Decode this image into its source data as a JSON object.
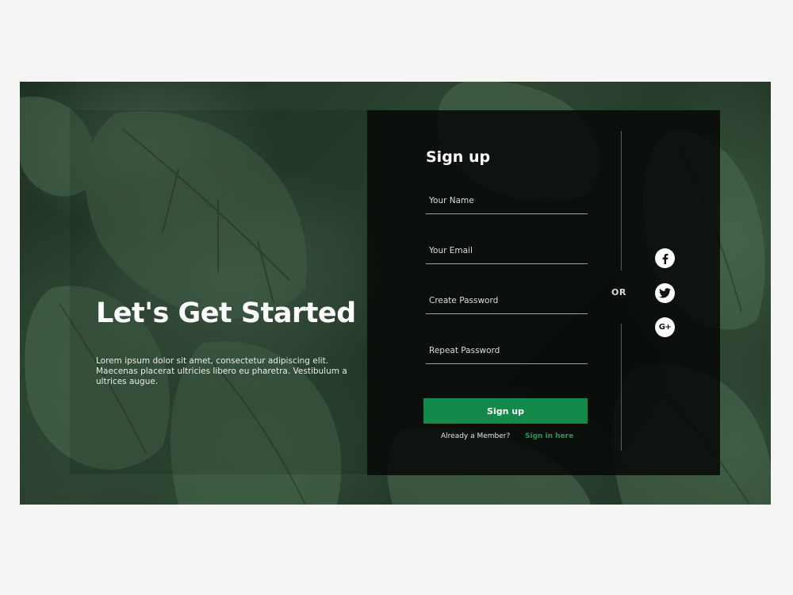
{
  "hero": {
    "title": "Let's Get Started",
    "text": "Lorem ipsum dolor sit amet, consectetur adipiscing elit. Maecenas placerat ultricies libero eu pharetra. Vestibulum a ultrices augue."
  },
  "form": {
    "title": "Sign up",
    "name_placeholder": "Your Name",
    "email_placeholder": "Your Email",
    "password_placeholder": "Create Password",
    "repeat_password_placeholder": "Repeat Password",
    "submit_label": "Sign up",
    "member_text": "Already a Member?",
    "signin_link": "Sign in here"
  },
  "social": {
    "or_label": "OR",
    "icons": [
      "facebook-icon",
      "twitter-icon",
      "google-plus-icon"
    ],
    "google_plus_glyph": "G+"
  },
  "colors": {
    "accent": "#138a4a",
    "link": "#1c9b55",
    "panel": "#060807",
    "page_bg": "#f5f5f3"
  }
}
